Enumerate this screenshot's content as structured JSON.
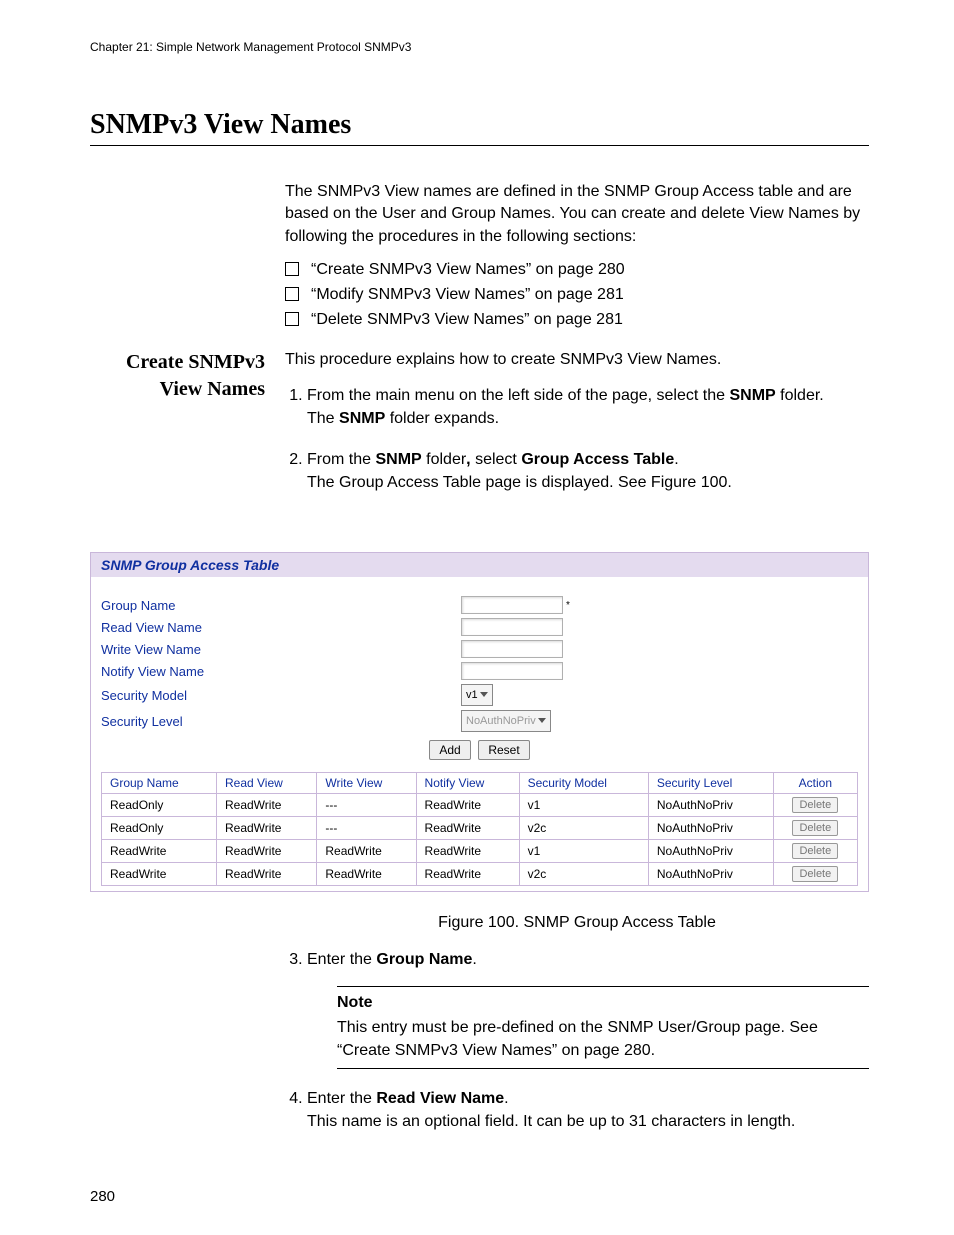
{
  "chapter_header": "Chapter 21: Simple Network Management Protocol SNMPv3",
  "section_title": "SNMPv3 View Names",
  "intro_para": "The SNMPv3 View names are defined in the SNMP Group Access table and are based on the User and Group Names. You can create and delete View Names by following the procedures in the following sections:",
  "xrefs": [
    "“Create SNMPv3 View Names” on page 280",
    "“Modify SNMPv3 View Names” on page 281",
    "“Delete SNMPv3 View Names” on page 281"
  ],
  "subsection_heading": "Create SNMPv3 View Names",
  "sub_intro": "This procedure explains how to create SNMPv3 View Names.",
  "step1_a": "From the main menu on the left side of the page, select the ",
  "step1_bold": "SNMP",
  "step1_b": " folder.",
  "step1_c_a": "The ",
  "step1_c_bold": "SNMP",
  "step1_c_b": " folder expands.",
  "step2_a": "From the ",
  "step2_bold1": "SNMP",
  "step2_b": " folder",
  "step2_comma": ",",
  "step2_c": " select ",
  "step2_bold2": "Group Access Table",
  "step2_d": ".",
  "step2_e": "The Group Access Table page is displayed. See Figure 100.",
  "figure": {
    "title": "SNMP Group Access Table",
    "labels": {
      "group_name": "Group Name",
      "read_view": "Read View Name",
      "write_view": "Write View Name",
      "notify_view": "Notify View Name",
      "sec_model": "Security Model",
      "sec_level": "Security Level"
    },
    "sec_model_value": "v1",
    "sec_level_value": "NoAuthNoPriv",
    "btn_add": "Add",
    "btn_reset": "Reset",
    "table_headers": [
      "Group Name",
      "Read View",
      "Write View",
      "Notify View",
      "Security Model",
      "Security Level",
      "Action"
    ],
    "rows": [
      {
        "c0": "ReadOnly",
        "c1": "ReadWrite",
        "c2": "---",
        "c3": "ReadWrite",
        "c4": "v1",
        "c5": "NoAuthNoPriv",
        "act": "Delete"
      },
      {
        "c0": "ReadOnly",
        "c1": "ReadWrite",
        "c2": "---",
        "c3": "ReadWrite",
        "c4": "v2c",
        "c5": "NoAuthNoPriv",
        "act": "Delete"
      },
      {
        "c0": "ReadWrite",
        "c1": "ReadWrite",
        "c2": "ReadWrite",
        "c3": "ReadWrite",
        "c4": "v1",
        "c5": "NoAuthNoPriv",
        "act": "Delete"
      },
      {
        "c0": "ReadWrite",
        "c1": "ReadWrite",
        "c2": "ReadWrite",
        "c3": "ReadWrite",
        "c4": "v2c",
        "c5": "NoAuthNoPriv",
        "act": "Delete"
      }
    ]
  },
  "figure_caption": "Figure 100. SNMP Group Access Table",
  "step3_a": "Enter the ",
  "step3_bold": "Group Name",
  "step3_b": ".",
  "note_label": "Note",
  "note_text": "This entry must be pre-defined on the SNMP User/Group page. See “Create SNMPv3 View Names” on page 280.",
  "step4_a": "Enter the ",
  "step4_bold": "Read View Name",
  "step4_b": ".",
  "step4_c": "This name is an optional field. It can be up to 31 characters in length.",
  "page_number": "280"
}
